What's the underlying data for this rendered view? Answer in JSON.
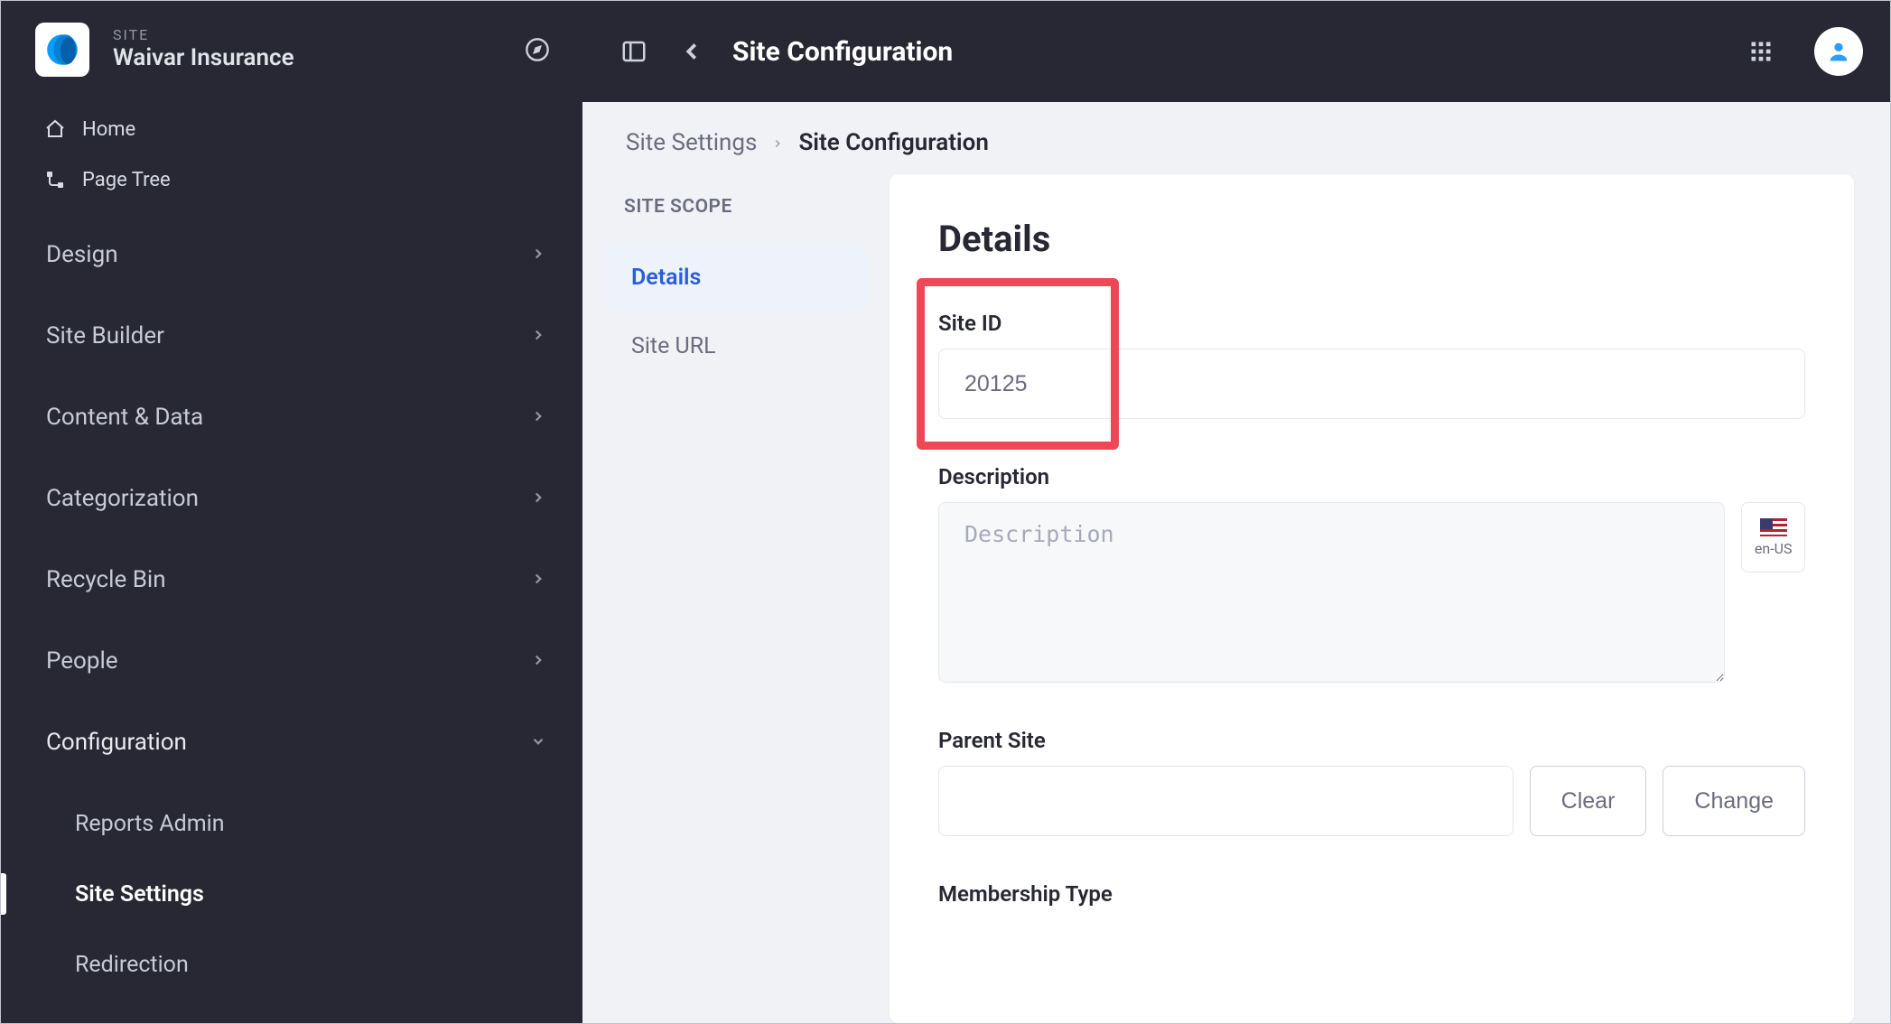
{
  "sidebar": {
    "eyebrow": "SITE",
    "site_name": "Waivar Insurance",
    "nav_home": "Home",
    "nav_page_tree": "Page Tree",
    "groups": {
      "design": "Design",
      "site_builder": "Site Builder",
      "content_data": "Content & Data",
      "categorization": "Categorization",
      "recycle_bin": "Recycle Bin",
      "people": "People",
      "configuration": "Configuration"
    },
    "config_children": {
      "reports_admin": "Reports Admin",
      "site_settings": "Site Settings",
      "redirection": "Redirection"
    }
  },
  "topbar": {
    "title": "Site Configuration"
  },
  "breadcrumb": {
    "parent": "Site Settings",
    "current": "Site Configuration"
  },
  "scope": {
    "heading": "SITE SCOPE",
    "details": "Details",
    "site_url": "Site URL"
  },
  "details": {
    "heading": "Details",
    "site_id_label": "Site ID",
    "site_id_value": "20125",
    "description_label": "Description",
    "description_placeholder": "Description",
    "locale": "en-US",
    "parent_site_label": "Parent Site",
    "clear_btn": "Clear",
    "change_btn": "Change",
    "membership_type_label": "Membership Type"
  }
}
